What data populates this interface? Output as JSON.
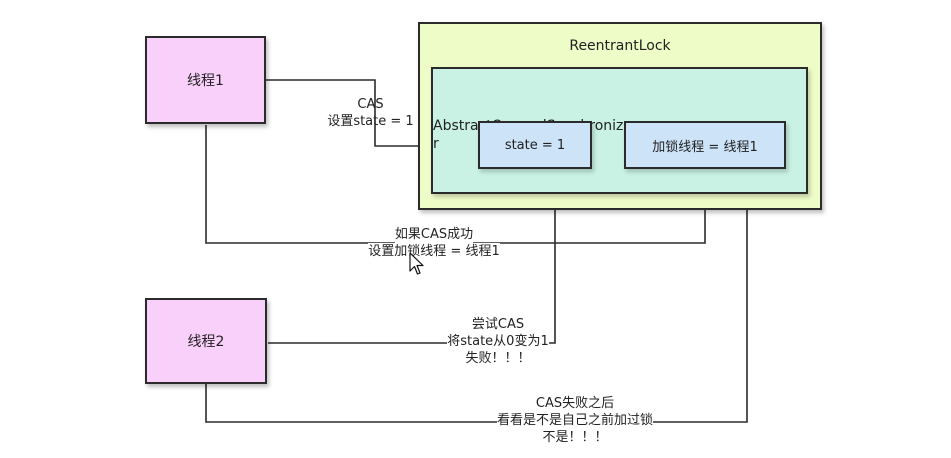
{
  "outer_box": {
    "title": "ReentrantLock"
  },
  "aqs_box": {
    "title_line1": "AbstractQueuedSynchronize",
    "title_line2": "r"
  },
  "state_box": {
    "label": "state = 1"
  },
  "lock_thread_box": {
    "label": "加锁线程 = 线程1"
  },
  "thread1": {
    "label": "线程1"
  },
  "thread2": {
    "label": "线程2"
  },
  "annotations": {
    "cas_set": {
      "line1": "CAS",
      "line2": "设置state = 1"
    },
    "cas_success": {
      "line1": "如果CAS成功",
      "line2": "设置加锁线程 = 线程1"
    },
    "cas_try": {
      "line1": "尝试CAS",
      "line2": "将state从0变为1",
      "line3": "失败！！！"
    },
    "cas_fail": {
      "line1": "CAS失败之后",
      "line2": "看看是不是自己之前加过锁",
      "line3": "不是！！！"
    }
  },
  "colors": {
    "thread_fill": "#f9d0f9",
    "outer_fill": "#eefcc8",
    "aqs_fill": "#c9f2e4",
    "inner_fill": "#cde3f8",
    "line": "#2b2b2b"
  }
}
